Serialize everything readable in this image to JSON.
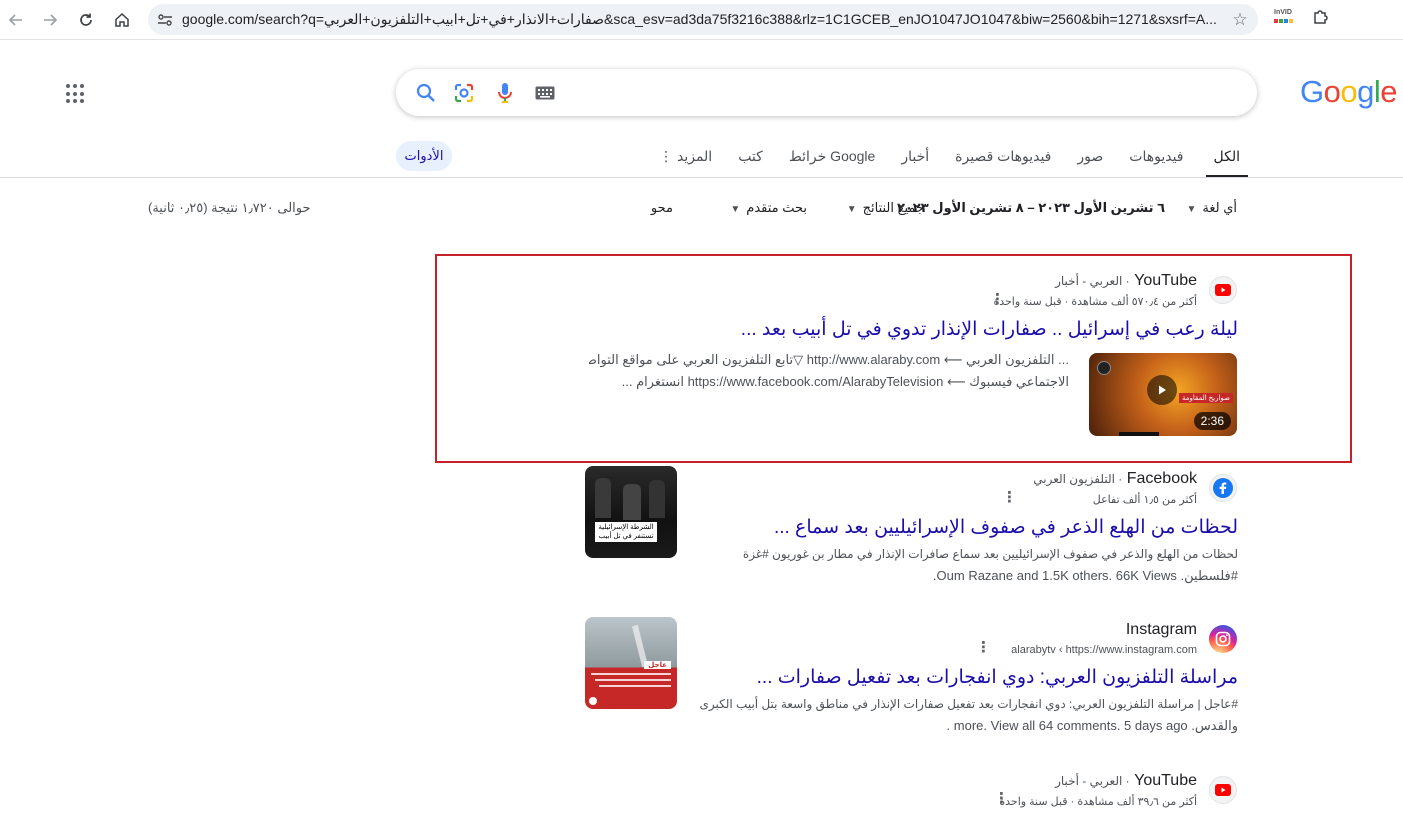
{
  "browser": {
    "url": "google.com/search?q=صفارات+الانذار+في+تل+ابيب+التلفزيون+العربي&sca_esv=ad3da75f3216c388&rlz=1C1GCEB_enJO1047JO1047&biw=2560&bih=1271&sxsrf=A...",
    "extension_label": "InVID"
  },
  "logo": {
    "letters": [
      "G",
      "o",
      "o",
      "g",
      "l",
      "e"
    ]
  },
  "tabs": [
    {
      "label": "الكل",
      "active": true
    },
    {
      "label": "فيديوهات"
    },
    {
      "label": "صور"
    },
    {
      "label": "فيديوهات قصيرة"
    },
    {
      "label": "أخبار"
    },
    {
      "label": "خرائط Google"
    },
    {
      "label": "كتب"
    },
    {
      "label": "المزيد"
    }
  ],
  "tools_button": "الأدوات",
  "toolsbar": {
    "language": "أي لغة",
    "date_range": "٦ تشرين الأول ٢٠٢٣ – ٨ تشرين الأول ٢٠٢٣",
    "all_results": "جميع النتائج",
    "advanced": "بحث متقدم",
    "clear": "محو"
  },
  "stats": "حوالى ١٫٧٢٠ نتيجة (٠٫٢٥ ثانية)",
  "results": [
    {
      "source": "YouTube",
      "source_sub": "· العربي - أخبار",
      "meta": "أكثر من ٥٧٠٫٤ ألف مشاهدة · قبل سنة واحدة",
      "title": "ليلة رعب في إسرائيل .. صفارات الإنذار تدوي في تل أبيب بعد ...",
      "snippet_line1": "... التلفزيون العربي ⟵ http://www.alaraby.com ▽تابع التلفزيون العربي على مواقع التواصل",
      "snippet_line2": "الاجتماعي فيسبوك ⟵ https://www.facebook.com/AlarabyTelevision انستغرام ...",
      "thumb_caption": "صواريخ المقاومة",
      "duration": "2:36"
    },
    {
      "source": "Facebook",
      "source_sub": "· التلفزيون العربي",
      "meta": "أكثر من ١٫٥ ألف تفاعل",
      "title": "لحظات من الهلع الذعر في صفوف الإسرائيليين بعد سماع ...",
      "snippet_line1": "لحظات من الهلع والذعر في صفوف الإسرائيليين بعد سماع صافرات الإنذار في مطار بن غوريون #غزة",
      "snippet_line2": "#فلسطين. Oum Razane and 1.5K others. 66K Views.",
      "thumb_caption": "الشرطة الإسرائيلية تستنفر في تل أبيب"
    },
    {
      "source": "Instagram",
      "meta": "alarabytv ‹ https://www.instagram.com",
      "title": "مراسلة التلفزيون العربي: دوي انفجارات بعد تفعيل صفارات ...",
      "snippet_line1": "#عاجل | مراسلة التلفزيون العربي: دوي انفجارات بعد تفعيل صفارات الإنذار في مناطق واسعة بتل أبيب الكبرى",
      "snippet_line2": "والقدس. more. View all 64 comments. 5 days ago .",
      "thumb_badge": "عاجل"
    },
    {
      "source": "YouTube",
      "source_sub": "· العربي - أخبار",
      "meta": "أكثر من ٣٩٫٦ ألف مشاهدة · قبل سنة واحدة"
    }
  ]
}
